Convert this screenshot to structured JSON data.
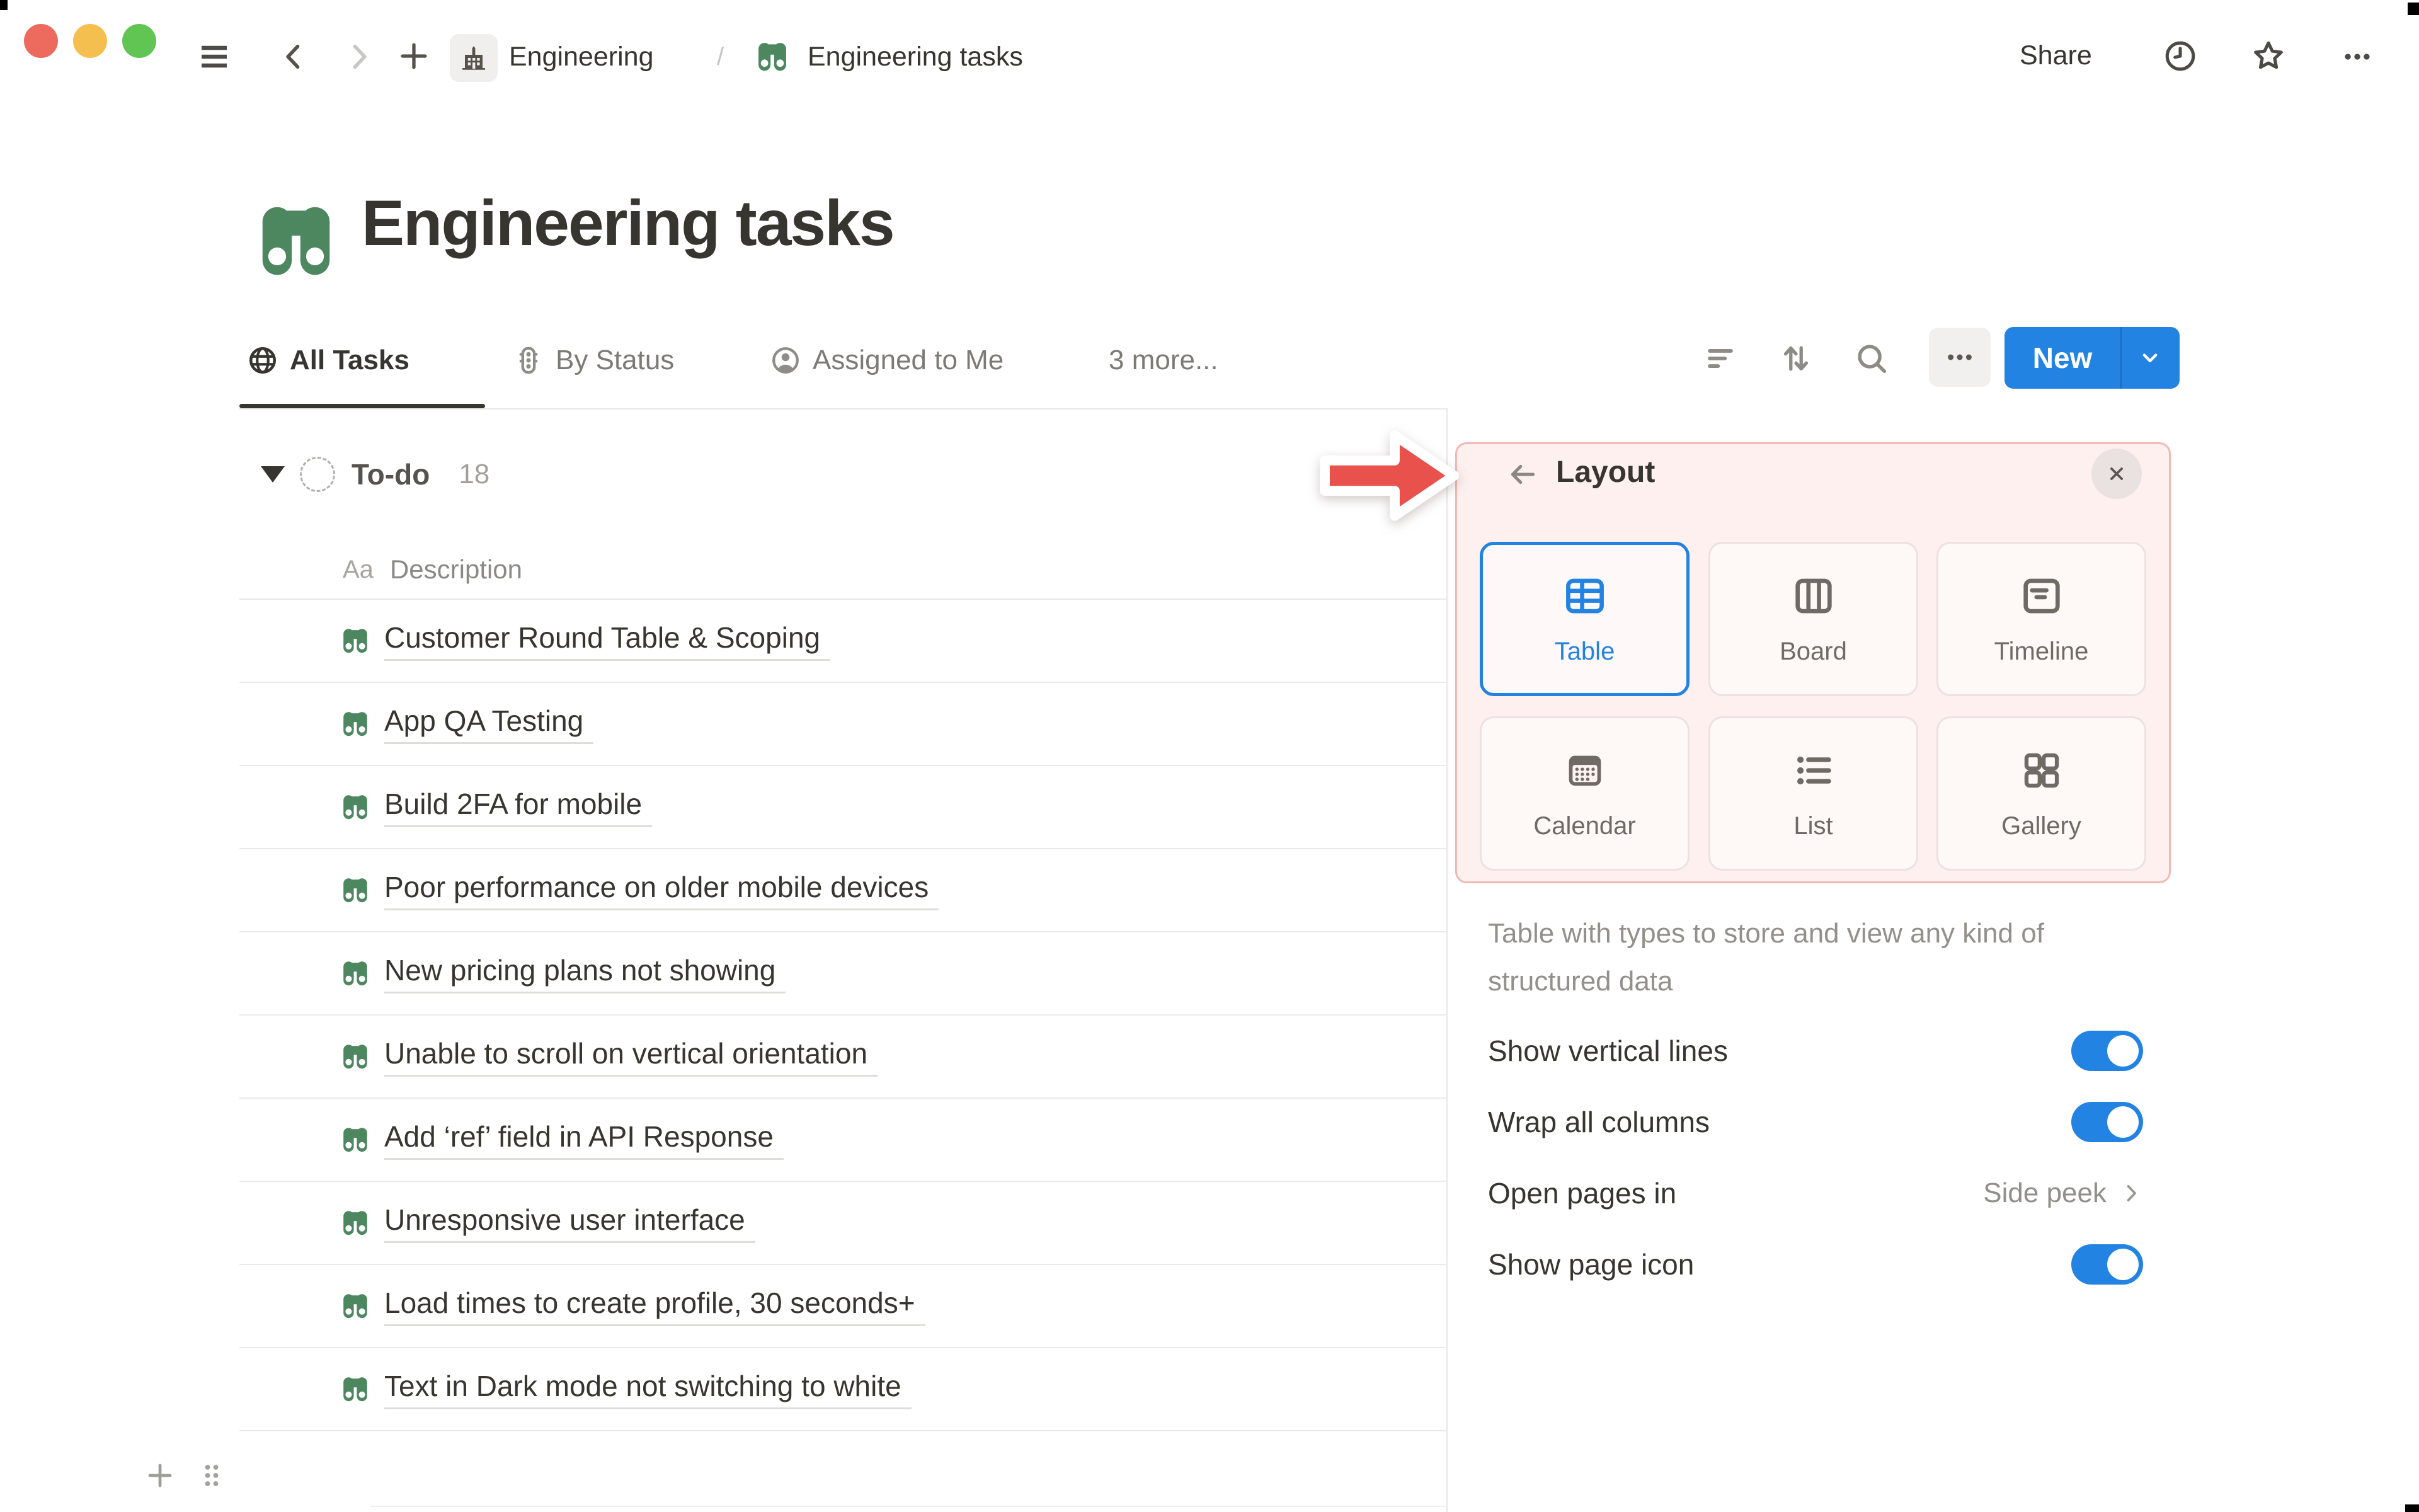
{
  "window": {
    "traffic_lights": [
      "close",
      "minimize",
      "zoom"
    ],
    "breadcrumb": {
      "workspace": "Engineering",
      "separator": "/",
      "page": "Engineering tasks"
    },
    "share_label": "Share"
  },
  "page": {
    "title": "Engineering tasks",
    "icon": "binoculars-icon"
  },
  "views": {
    "tabs": [
      {
        "label": "All Tasks",
        "icon": "globe-icon",
        "active": true
      },
      {
        "label": "By Status",
        "icon": "status-light-icon",
        "active": false
      },
      {
        "label": "Assigned to Me",
        "icon": "person-icon",
        "active": false
      },
      {
        "label": "3 more...",
        "icon": "",
        "active": false
      }
    ],
    "new_button_label": "New"
  },
  "table": {
    "group": {
      "name": "To-do",
      "count": "18"
    },
    "column_header": {
      "type_abbrev": "Aa",
      "label": "Description"
    },
    "rows": [
      "Customer Round Table & Scoping",
      "App QA Testing",
      "Build 2FA for mobile",
      "Poor performance on older mobile devices",
      "New pricing plans not showing",
      "Unable to scroll on vertical orientation",
      "Add ‘ref’ field in API Response",
      "Unresponsive user interface",
      "Load times to create profile, 30 seconds+",
      "Text in Dark mode not switching to white"
    ]
  },
  "layout_panel": {
    "title": "Layout",
    "options": [
      {
        "label": "Table",
        "icon": "table-layout-icon",
        "selected": true
      },
      {
        "label": "Board",
        "icon": "board-layout-icon",
        "selected": false
      },
      {
        "label": "Timeline",
        "icon": "timeline-layout-icon",
        "selected": false
      },
      {
        "label": "Calendar",
        "icon": "calendar-layout-icon",
        "selected": false
      },
      {
        "label": "List",
        "icon": "list-layout-icon",
        "selected": false
      },
      {
        "label": "Gallery",
        "icon": "gallery-layout-icon",
        "selected": false
      }
    ],
    "description": "Table with types to store and view any kind of structured data",
    "settings": [
      {
        "label": "Show vertical lines",
        "control": "toggle",
        "value": "on"
      },
      {
        "label": "Wrap all columns",
        "control": "toggle",
        "value": "on"
      },
      {
        "label": "Open pages in",
        "control": "submenu",
        "value": "Side peek"
      },
      {
        "label": "Show page icon",
        "control": "toggle",
        "value": "on"
      }
    ]
  },
  "colors": {
    "accent_blue": "#2383e2",
    "icon_green": "#4d8760",
    "annotation_red": "#e9514d",
    "highlight_pink": "#fdf0ef",
    "traffic_red": "#ec6a5e",
    "traffic_yellow": "#f5bf4f",
    "traffic_green": "#61c554"
  }
}
